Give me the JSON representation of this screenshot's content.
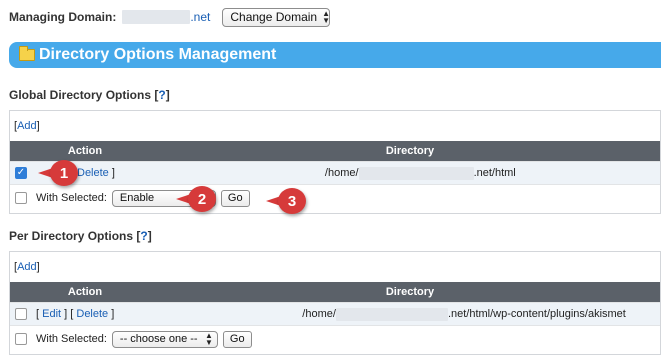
{
  "managing": {
    "label": "Managing Domain:",
    "domain_suffix": ".net",
    "change_button": "Change Domain"
  },
  "section": {
    "title": "Directory Options Management"
  },
  "global": {
    "heading": "Global Directory Options",
    "help": "?",
    "add": "Add",
    "col_action": "Action",
    "col_directory": "Directory",
    "row": {
      "delete": "Delete",
      "dir_prefix": "/home/",
      "dir_suffix": ".net/html",
      "checked": true
    },
    "with_selected": "With Selected:",
    "select_value": "Enable",
    "go": "Go"
  },
  "perdir": {
    "heading": "Per Directory Options",
    "help": "?",
    "add": "Add",
    "col_action": "Action",
    "col_directory": "Directory",
    "row": {
      "edit": "Edit",
      "delete": "Delete",
      "dir_prefix": "/home/",
      "dir_suffix": ".net/html/wp-content/plugins/akismet",
      "checked": false
    },
    "with_selected": "With Selected:",
    "select_value": "-- choose one --",
    "go": "Go"
  },
  "callouts": [
    "1",
    "2",
    "3"
  ],
  "colors": {
    "header_blue": "#46a9ea",
    "table_head": "#5b6169",
    "callout_red": "#d63a3a",
    "link": "#1a5fb4"
  },
  "icons": {
    "folder": "folder-icon",
    "select_arrows": "updown-arrows-icon",
    "check": "checkmark-icon"
  }
}
